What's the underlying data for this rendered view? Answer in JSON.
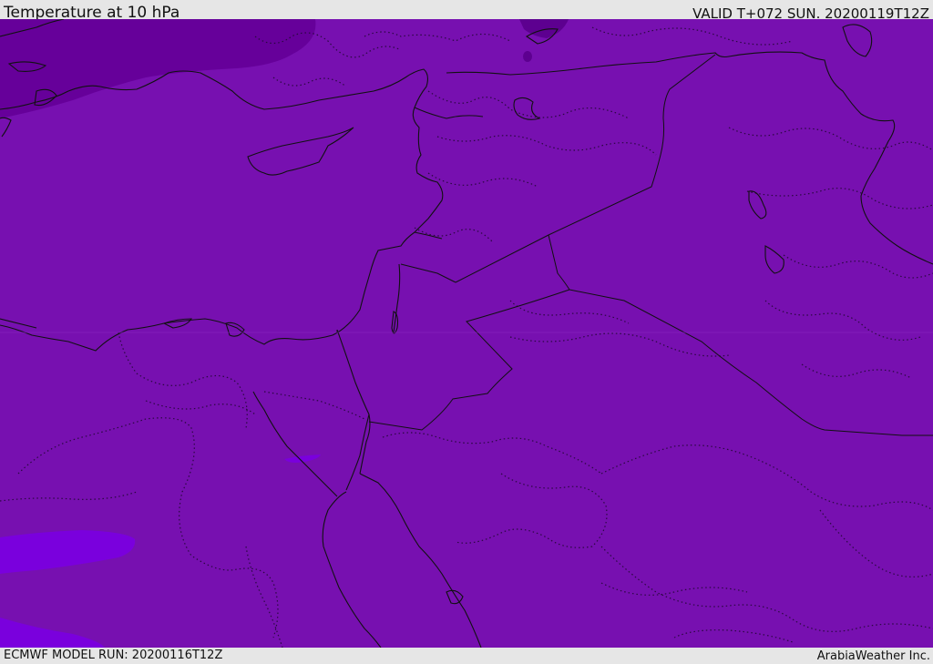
{
  "header": {
    "title": "Temperature at 10 hPa",
    "valid_time": "VALID T+072 SUN. 20200119T12Z"
  },
  "footer": {
    "model_run": "ECMWF MODEL RUN: 20200116T12Z",
    "credit": "ArabiaWeather Inc."
  },
  "map": {
    "region": "Eastern Mediterranean and Middle East",
    "colors": {
      "background_field": "#7710b0",
      "cold_pocket_north": "#66009a",
      "cold_pocket_north_dark": "#5d0090",
      "warmer_pocket_southwest": "#7a00dd",
      "coastline": "#111111",
      "border": "#111111",
      "admin_border_dotted": "#2a0840"
    }
  }
}
